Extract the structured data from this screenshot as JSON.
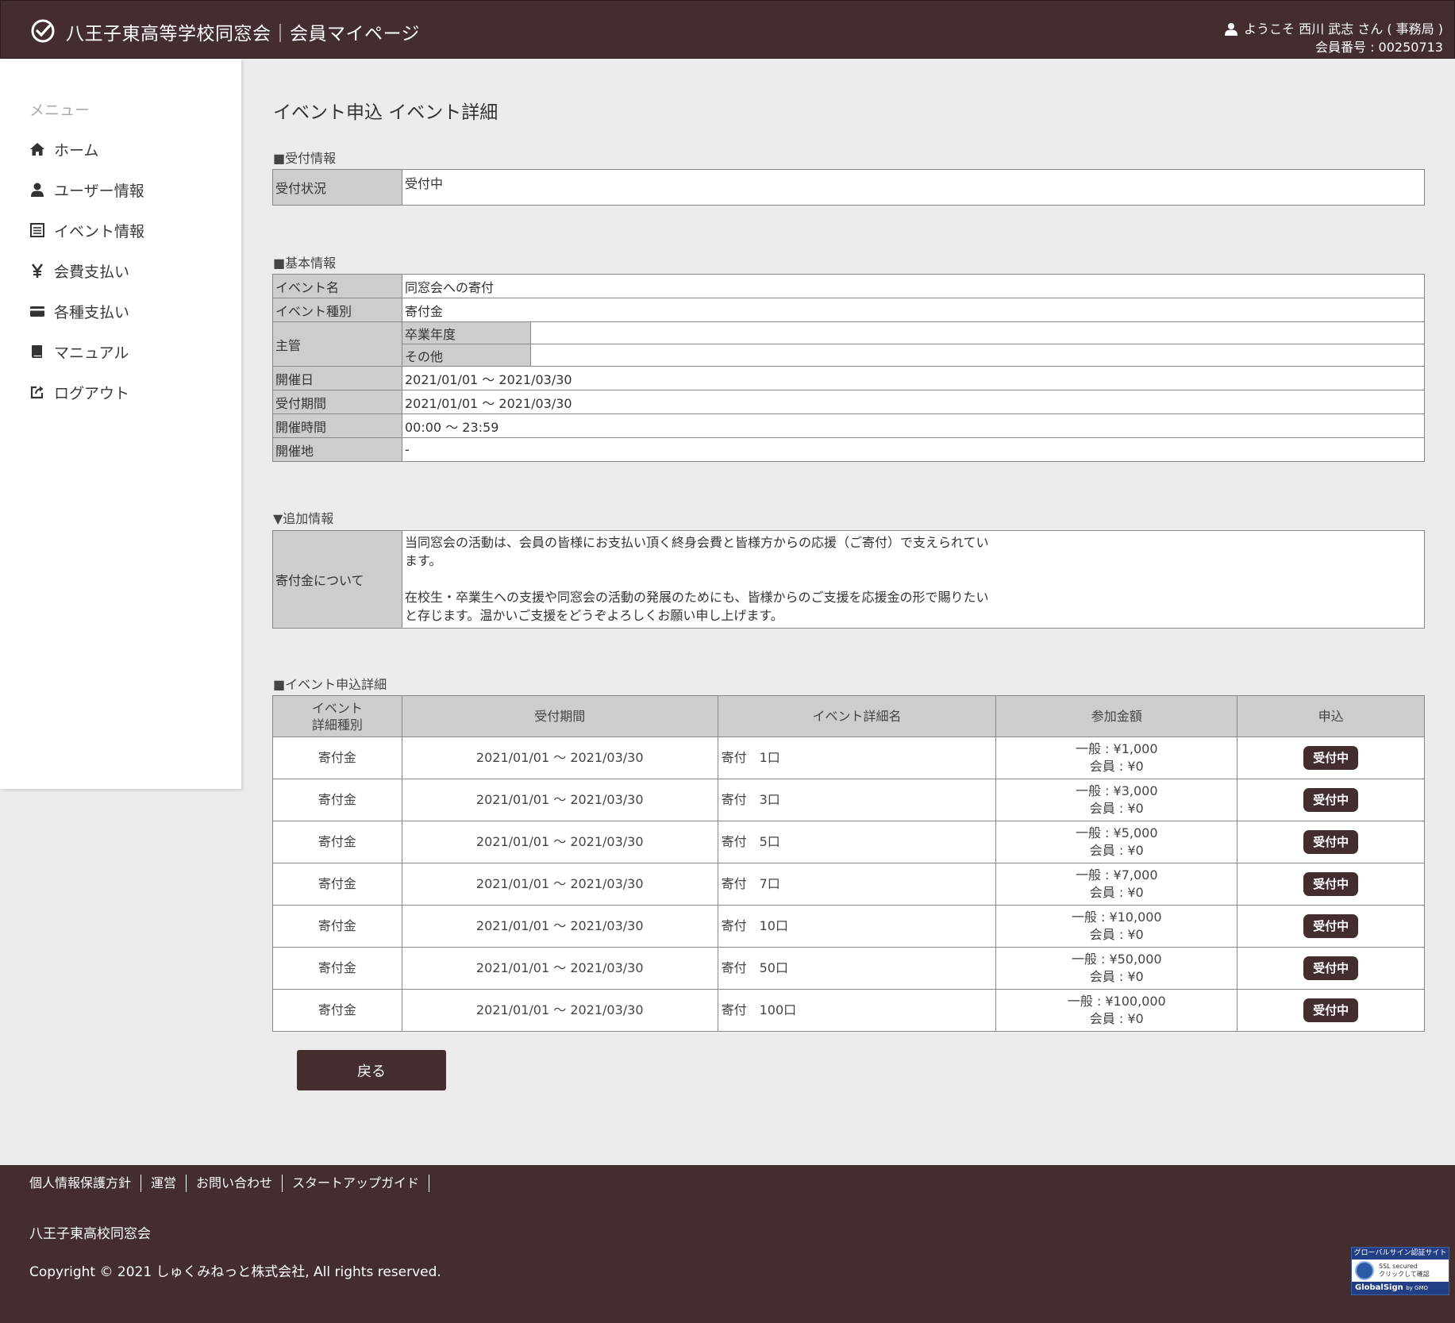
{
  "header": {
    "title": "八王子東高等学校同窓会｜会員マイページ",
    "welcome": "ようこそ 西川 武志 さん ( 事務局 )",
    "member_no": "会員番号 : 00250713"
  },
  "sidebar": {
    "title": "メニュー",
    "items": [
      {
        "label": "ホーム",
        "icon": "home-icon"
      },
      {
        "label": "ユーザー情報",
        "icon": "user-icon"
      },
      {
        "label": "イベント情報",
        "icon": "list-icon"
      },
      {
        "label": "会費支払い",
        "icon": "yen-icon"
      },
      {
        "label": "各種支払い",
        "icon": "credit-card-icon"
      },
      {
        "label": "マニュアル",
        "icon": "book-icon"
      },
      {
        "label": "ログアウト",
        "icon": "logout-icon"
      }
    ]
  },
  "page": {
    "title": "イベント申込 イベント詳細",
    "reception_section": "■受付情報",
    "reception_status_label": "受付状況",
    "reception_status": "受付中",
    "basic_section": "■基本情報",
    "basic": {
      "event_name_label": "イベント名",
      "event_name": "同窓会への寄付",
      "event_type_label": "イベント種別",
      "event_type": "寄付金",
      "organizer_label": "主管",
      "graduation_year_label": "卒業年度",
      "graduation_year": "",
      "other_label": "その他",
      "other": "",
      "date_label": "開催日",
      "date": "2021/01/01 ～ 2021/03/30",
      "period_label": "受付期間",
      "period": "2021/01/01 ～ 2021/03/30",
      "time_label": "開催時間",
      "time": "00:00 ～ 23:59",
      "venue_label": "開催地",
      "venue": "-"
    },
    "additional_section": "▼追加情報",
    "donation_label": "寄付金について",
    "donation_p1_l1": "当同窓会の活動は、会員の皆様にお支払い頂く終身会費と皆様方からの応援（ご寄付）で支えられてい",
    "donation_p1_l2": "ます。",
    "donation_p2_l1": "在校生・卒業生への支援や同窓会の活動の発展のためにも、皆様からのご支援を応援金の形で賜りたい",
    "donation_p2_l2": "と存じます。温かいご支援をどうぞよろしくお願い申し上げます。",
    "apply_section": "■イベント申込詳細",
    "table_headers": {
      "type_l1": "イベント",
      "type_l2": "詳細種別",
      "period": "受付期間",
      "name": "イベント詳細名",
      "fee": "参加金額",
      "apply": "申込"
    },
    "rows": [
      {
        "type": "寄付金",
        "period": "2021/01/01 ～ 2021/03/30",
        "name": "寄付　1口",
        "general": "一般 : ¥1,000",
        "member": "会員 : ¥0",
        "status": "受付中"
      },
      {
        "type": "寄付金",
        "period": "2021/01/01 ～ 2021/03/30",
        "name": "寄付　3口",
        "general": "一般 : ¥3,000",
        "member": "会員 : ¥0",
        "status": "受付中"
      },
      {
        "type": "寄付金",
        "period": "2021/01/01 ～ 2021/03/30",
        "name": "寄付　5口",
        "general": "一般 : ¥5,000",
        "member": "会員 : ¥0",
        "status": "受付中"
      },
      {
        "type": "寄付金",
        "period": "2021/01/01 ～ 2021/03/30",
        "name": "寄付　7口",
        "general": "一般 : ¥7,000",
        "member": "会員 : ¥0",
        "status": "受付中"
      },
      {
        "type": "寄付金",
        "period": "2021/01/01 ～ 2021/03/30",
        "name": "寄付　10口",
        "general": "一般 : ¥10,000",
        "member": "会員 : ¥0",
        "status": "受付中"
      },
      {
        "type": "寄付金",
        "period": "2021/01/01 ～ 2021/03/30",
        "name": "寄付　50口",
        "general": "一般 : ¥50,000",
        "member": "会員 : ¥0",
        "status": "受付中"
      },
      {
        "type": "寄付金",
        "period": "2021/01/01 ～ 2021/03/30",
        "name": "寄付　100口",
        "general": "一般 : ¥100,000",
        "member": "会員 : ¥0",
        "status": "受付中"
      }
    ],
    "back_label": "戻る"
  },
  "footer": {
    "links": [
      "個人情報保護方針",
      "運営",
      "お問い合わせ",
      "スタートアップガイド"
    ],
    "org": "八王子東高校同窓会",
    "copyright": "Copyright © 2021 しゅくみねっと株式会社, All rights reserved.",
    "badge_top": "グローバルサイン認証サイト",
    "badge_ssl": "SSL secured",
    "badge_click": "クリックして確認",
    "badge_brand": "GlobalSign",
    "badge_by": "by GMO"
  },
  "colors": {
    "brand": "#432d2f",
    "background": "#ececec",
    "table_header": "#cdcdcd"
  }
}
